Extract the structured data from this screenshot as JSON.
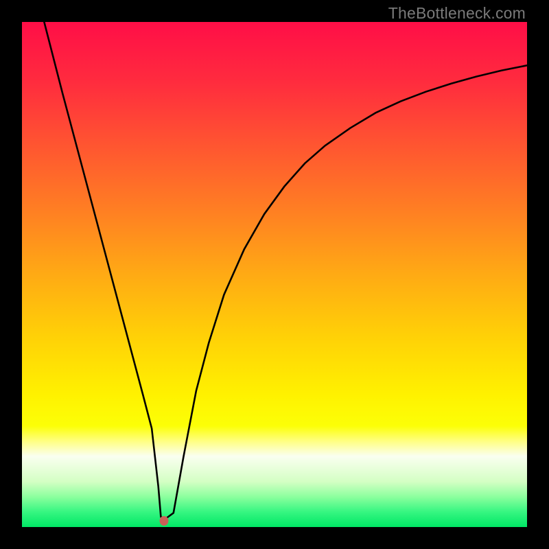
{
  "watermark": "TheBottleneck.com",
  "chart_data": {
    "type": "line",
    "title": "",
    "xlabel": "",
    "ylabel": "",
    "xlim": [
      0,
      100
    ],
    "ylim": [
      0,
      100
    ],
    "grid": false,
    "series": [
      {
        "name": "curve",
        "x": [
          4.4,
          8,
          12,
          16,
          20,
          24,
          25.7,
          27,
          27.5,
          28.5,
          30,
          32,
          34.5,
          37,
          40,
          44,
          48,
          52,
          56,
          60,
          65,
          70,
          75,
          80,
          85,
          90,
          95,
          100
        ],
        "y": [
          100,
          86,
          71,
          56,
          41,
          26,
          19.5,
          8,
          2.0,
          1.7,
          2.8,
          14,
          27,
          36.5,
          46,
          55,
          62,
          67.5,
          72,
          75.5,
          79,
          82,
          84.3,
          86.2,
          87.8,
          89.2,
          90.4,
          91.4
        ]
      }
    ],
    "marker": {
      "x": 28.1,
      "y": 1.2,
      "color": "#c96058"
    },
    "gradient": {
      "type": "linear-vertical",
      "stops": [
        {
          "offset": 0.0,
          "color": "#ff0e47"
        },
        {
          "offset": 0.12,
          "color": "#ff2c3e"
        },
        {
          "offset": 0.25,
          "color": "#ff5730"
        },
        {
          "offset": 0.38,
          "color": "#ff8122"
        },
        {
          "offset": 0.5,
          "color": "#ffaa14"
        },
        {
          "offset": 0.62,
          "color": "#ffd007"
        },
        {
          "offset": 0.74,
          "color": "#fff200"
        },
        {
          "offset": 0.8,
          "color": "#fcff07"
        },
        {
          "offset": 0.83,
          "color": "#ffff82"
        },
        {
          "offset": 0.86,
          "color": "#fafff0"
        },
        {
          "offset": 0.91,
          "color": "#d4ffc4"
        },
        {
          "offset": 0.94,
          "color": "#8cff9e"
        },
        {
          "offset": 0.97,
          "color": "#36f681"
        },
        {
          "offset": 1.0,
          "color": "#00e765"
        }
      ]
    }
  }
}
